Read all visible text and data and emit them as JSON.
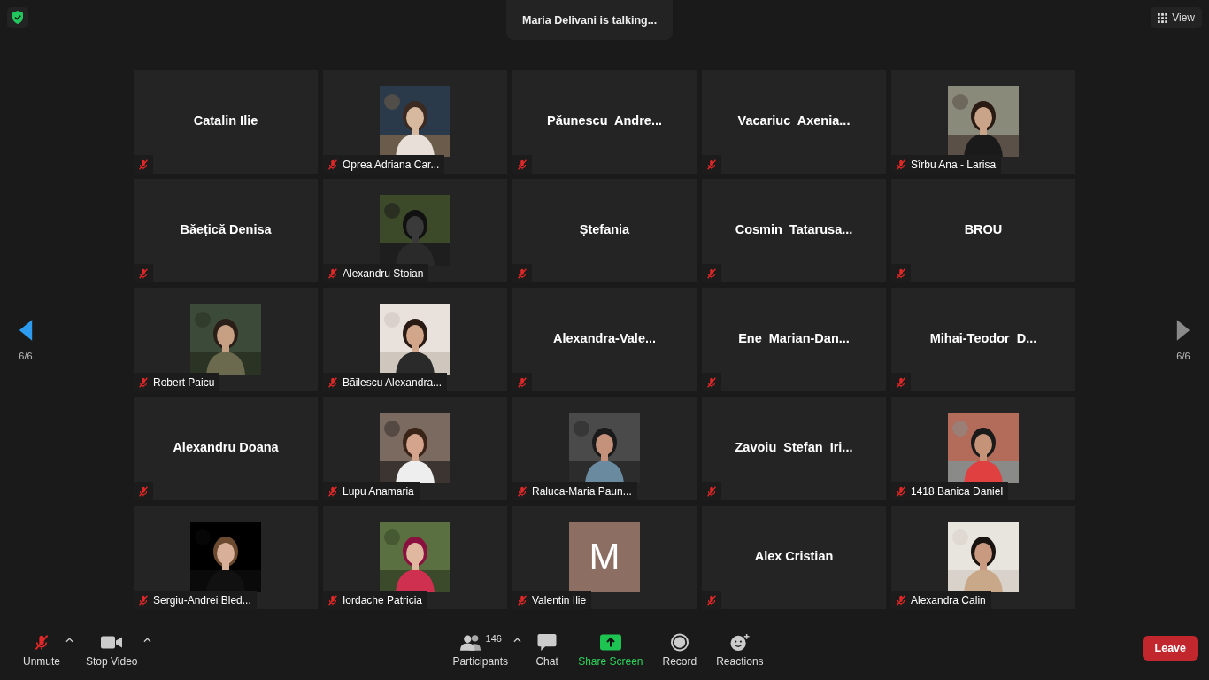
{
  "header": {
    "talking": "Maria Delivani is talking...",
    "view_button": "View"
  },
  "nav": [
    {
      "kind": "prev",
      "page": "6/6",
      "enabled": true
    },
    {
      "kind": "next",
      "page": "6/6",
      "enabled": false
    }
  ],
  "tiles": [
    {
      "kind": "name",
      "name": "Catalin Ilie",
      "muted": true
    },
    {
      "kind": "picture",
      "name": "Oprea Adriana Car...",
      "muted": true
    },
    {
      "kind": "name",
      "name": "Păunescu  Andre...",
      "muted": true
    },
    {
      "kind": "name",
      "name": "Vacariuc  Axenia...",
      "muted": true
    },
    {
      "kind": "picture",
      "name": "Sîrbu Ana - Larisa",
      "muted": true
    },
    {
      "kind": "name",
      "name": "Băețică Denisa",
      "muted": true
    },
    {
      "kind": "picture",
      "name": "Alexandru Stoian",
      "muted": true
    },
    {
      "kind": "name",
      "name": "Ștefania",
      "muted": true
    },
    {
      "kind": "name",
      "name": "Cosmin  Tatarusa...",
      "muted": true
    },
    {
      "kind": "name",
      "name": "BROU",
      "muted": true
    },
    {
      "kind": "picture",
      "name": "Robert Paicu",
      "muted": true
    },
    {
      "kind": "picture",
      "name": "Băilescu Alexandra...",
      "muted": true
    },
    {
      "kind": "name",
      "name": "Alexandra-Vale...",
      "muted": true
    },
    {
      "kind": "name",
      "name": "Ene  Marian-Dan...",
      "muted": true
    },
    {
      "kind": "name",
      "name": "Mihai-Teodor  D...",
      "muted": true
    },
    {
      "kind": "name",
      "name": "Alexandru Doana",
      "muted": true
    },
    {
      "kind": "picture",
      "name": "Lupu Anamaria",
      "muted": true
    },
    {
      "kind": "picture",
      "name": "Raluca-Maria Paun...",
      "muted": true
    },
    {
      "kind": "name",
      "name": "Zavoiu  Stefan  Iri...",
      "muted": true
    },
    {
      "kind": "picture",
      "name": "1418 Banica Daniel",
      "muted": true
    },
    {
      "kind": "picture",
      "name": "Sergiu-Andrei Bled...",
      "muted": true
    },
    {
      "kind": "picture",
      "name": "Iordache Patricia",
      "muted": true
    },
    {
      "kind": "avatar",
      "letter": "M",
      "name": "Valentin Ilie",
      "muted": true
    },
    {
      "kind": "name",
      "name": "Alex Cristian",
      "muted": true
    },
    {
      "kind": "picture",
      "name": "Alexandra Calin",
      "muted": true
    }
  ],
  "toolbar": {
    "left": [
      {
        "kind": "audio",
        "label": "Unmute",
        "muted": true,
        "has_menu": true
      },
      {
        "kind": "video",
        "label": "Stop Video",
        "has_menu": true
      }
    ],
    "center": [
      {
        "kind": "participants",
        "label": "Participants",
        "count": "146",
        "has_menu": true
      },
      {
        "kind": "chat",
        "label": "Chat",
        "has_menu": false
      },
      {
        "kind": "share",
        "label": "Share Screen",
        "has_menu": false
      },
      {
        "kind": "record",
        "label": "Record",
        "has_menu": false
      },
      {
        "kind": "reactions",
        "label": "Reactions",
        "has_menu": false
      }
    ],
    "leave": "Leave"
  }
}
